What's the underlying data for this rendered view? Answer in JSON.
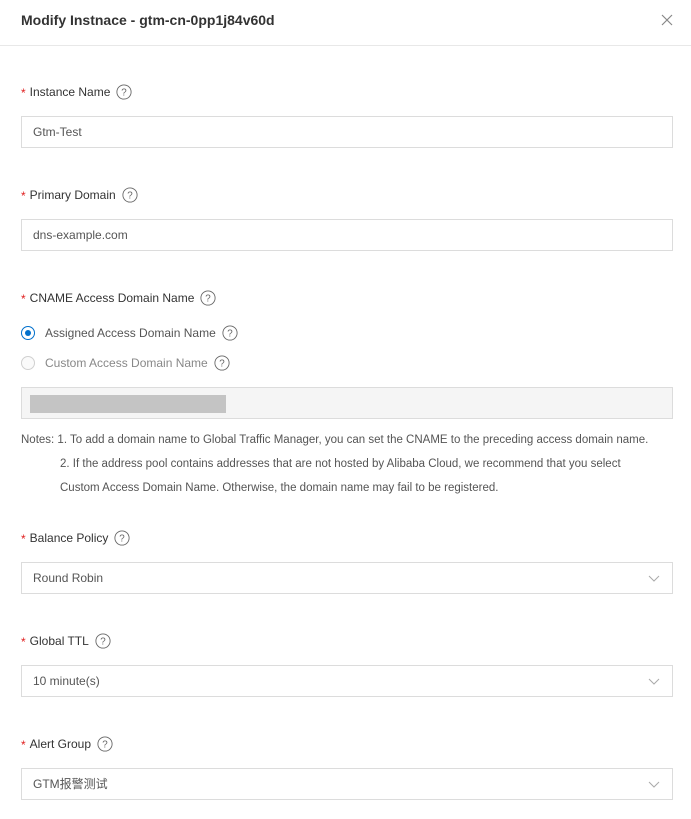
{
  "header": {
    "title": "Modify Instnace - gtm-cn-0pp1j84v60d"
  },
  "icons": {
    "close": "close-icon",
    "help": "question-circle-icon",
    "chevron": "chevron-down-icon"
  },
  "colors": {
    "required": "#e02020",
    "accent": "#0070cc"
  },
  "form": {
    "instance_name": {
      "label": "Instance Name",
      "value": "Gtm-Test"
    },
    "primary_domain": {
      "label": "Primary Domain",
      "value": "dns-example.com"
    },
    "cname": {
      "label": "CNAME Access Domain Name",
      "options": [
        {
          "label": "Assigned Access Domain Name",
          "selected": true
        },
        {
          "label": "Custom Access Domain Name",
          "selected": false
        }
      ],
      "value": ""
    },
    "notes": {
      "line1": "Notes: 1. To add a domain name to Global Traffic Manager, you can set the CNAME to the preceding access domain name.",
      "line2": "2. If the address pool contains addresses that are not hosted by Alibaba Cloud, we recommend that you select",
      "line3": "Custom Access Domain Name. Otherwise, the domain name may fail to be registered."
    },
    "balance_policy": {
      "label": "Balance Policy",
      "value": "Round Robin"
    },
    "global_ttl": {
      "label": "Global TTL",
      "value": "10 minute(s)"
    },
    "alert_group": {
      "label": "Alert Group",
      "value": "GTM报警测试"
    }
  }
}
